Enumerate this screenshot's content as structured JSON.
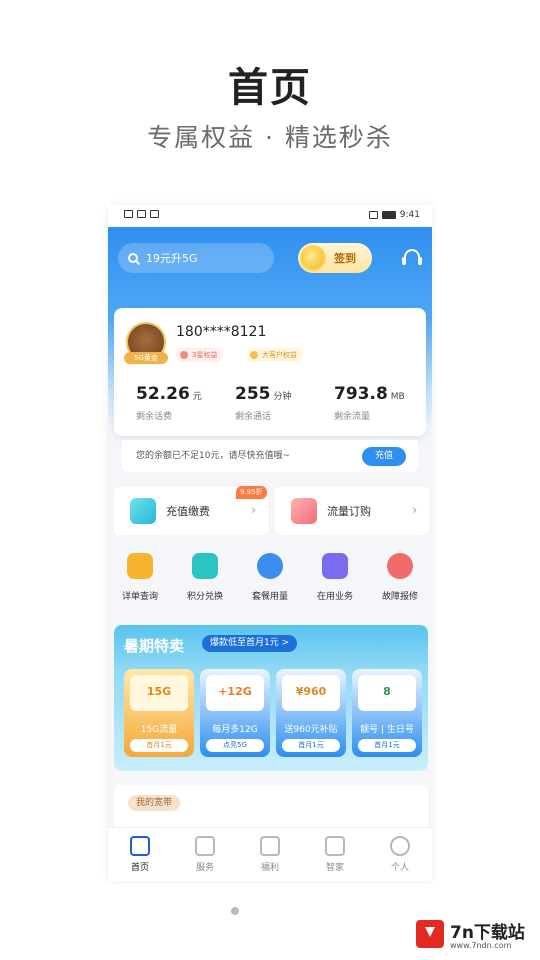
{
  "promo": {
    "title": "首页",
    "subtitle": "专属权益 · 精选秒杀"
  },
  "status_bar": {
    "time": "9:41"
  },
  "header": {
    "search_placeholder": "19元升5G",
    "signin_label": "签到",
    "service_icon": "headset-icon"
  },
  "user": {
    "phone": "180****8121",
    "level_badge": "5G黄金",
    "tags": [
      "3星权益",
      "大客户权益"
    ],
    "stats": [
      {
        "value": "52.26",
        "unit": "元",
        "label": "剩余话费"
      },
      {
        "value": "255",
        "unit": "分钟",
        "label": "剩余通话"
      },
      {
        "value": "793.8",
        "unit": "MB",
        "label": "剩余流量"
      }
    ]
  },
  "notice": {
    "text": "您的余额已不足10元，请尽快充值哦~",
    "button": "充值"
  },
  "quick_cards": [
    {
      "label": "充值缴费",
      "badge": "9.95折",
      "icon": "wallet-icon"
    },
    {
      "label": "流量订购",
      "icon": "data-package-icon"
    }
  ],
  "services": [
    {
      "label": "详单查询",
      "icon": "detail-icon",
      "color": "#f6b52c"
    },
    {
      "label": "积分兑换",
      "icon": "gift-icon",
      "color": "#2cc3c3"
    },
    {
      "label": "套餐用量",
      "icon": "pie-chart-icon",
      "color": "#3b8ef0"
    },
    {
      "label": "在用业务",
      "icon": "list-icon",
      "color": "#7a6cf0"
    },
    {
      "label": "故障报修",
      "icon": "wrench-icon",
      "color": "#f26b6b"
    }
  ],
  "summer_sale": {
    "title": "暑期特卖",
    "pill": "爆款低至首月1元 >",
    "items": [
      {
        "pic_label": "15G",
        "name": "15G流量",
        "button": "首月1元"
      },
      {
        "pic_label": "+12G",
        "name": "每月多12G",
        "button": "点亮5G"
      },
      {
        "pic_label": "¥960",
        "name": "送960元补贴",
        "button": "首月1元"
      },
      {
        "pic_label": "8",
        "name": "靓号 | 生日号",
        "button": "首月1元"
      }
    ]
  },
  "broadband": {
    "title": "我的宽带"
  },
  "tabbar": [
    {
      "label": "首页",
      "icon": "home-icon",
      "active": true
    },
    {
      "label": "服务",
      "icon": "grid-icon"
    },
    {
      "label": "福利",
      "icon": "gift-box-icon"
    },
    {
      "label": "智家",
      "icon": "tv-icon"
    },
    {
      "label": "个人",
      "icon": "person-icon"
    }
  ],
  "watermark": {
    "name": "7n下载站",
    "url": "www.7ndn.com"
  }
}
